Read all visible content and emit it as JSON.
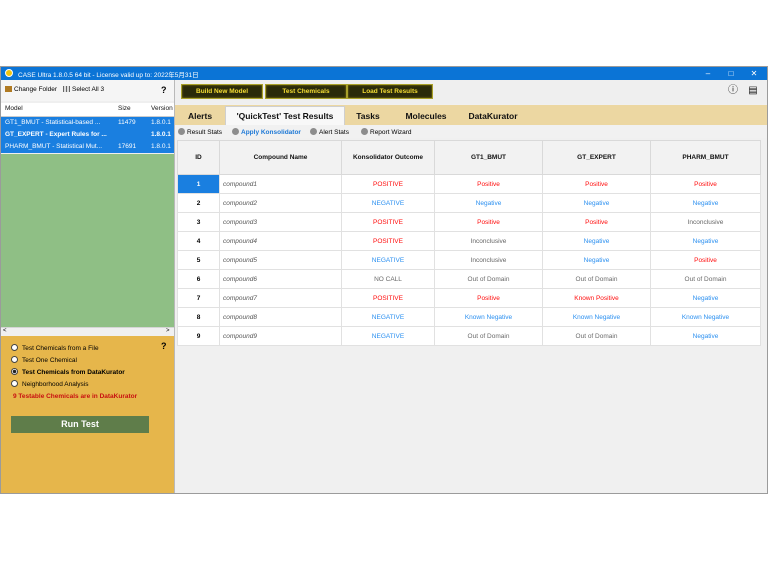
{
  "window": {
    "title": "CASE Ultra 1.8.0.5 64 bit  - License valid up to: 2022年5月31日",
    "controls": [
      "–",
      "□",
      "✕"
    ]
  },
  "left": {
    "toolbar": {
      "change_folder": "Change Folder",
      "select_all": "Select All 3",
      "help": "?"
    },
    "model_list": {
      "headers": {
        "model": "Model",
        "size": "Size",
        "version": "Version"
      },
      "rows": [
        {
          "model": "GT1_BMUT - Statistical-based ...",
          "size": "11479",
          "version": "1.8.0.1",
          "bold": false
        },
        {
          "model": "GT_EXPERT - Expert Rules for ...",
          "size": "",
          "version": "1.8.0.1",
          "bold": true
        },
        {
          "model": "PHARM_BMUT - Statistical Mut...",
          "size": "17691",
          "version": "1.8.0.1",
          "bold": false
        }
      ]
    },
    "scroll_left": "<",
    "scroll_right": ">",
    "options": {
      "help": "?",
      "items": [
        {
          "label": "Test Chemicals from a File",
          "selected": false
        },
        {
          "label": "Test One Chemical",
          "selected": false
        },
        {
          "label": "Test Chemicals from DataKurator",
          "selected": true
        },
        {
          "label": "Neighborhood Analysis",
          "selected": false
        }
      ],
      "status": "9 Testable Chemicals are in DataKurator",
      "run_button": "Run Test"
    }
  },
  "right": {
    "toolbar": {
      "build_model": "Build New Model",
      "test_chemicals": "Test Chemicals",
      "load_results": "Load Test Results",
      "info_icon": "ⓘ",
      "book_icon": "▤"
    },
    "tabs": [
      "Alerts",
      "'QuickTest' Test Results",
      "Tasks",
      "Molecules",
      "DataKurator"
    ],
    "active_tab": 1,
    "subtabs": [
      "Result Stats",
      "Apply Konsolidator",
      "Alert Stats",
      "Report Wizard"
    ],
    "active_subtab": 1,
    "table": {
      "headers": [
        "ID",
        "Compound Name",
        "Konsolidator Outcome",
        "GT1_BMUT",
        "GT_EXPERT",
        "PHARM_BMUT"
      ],
      "rows": [
        [
          "1",
          "compound1",
          "POSITIVE",
          "Positive",
          "Positive",
          "Positive"
        ],
        [
          "2",
          "compound2",
          "NEGATIVE",
          "Negative",
          "Negative",
          "Negative"
        ],
        [
          "3",
          "compound3",
          "POSITIVE",
          "Positive",
          "Positive",
          "Inconclusive"
        ],
        [
          "4",
          "compound4",
          "POSITIVE",
          "Inconclusive",
          "Negative",
          "Negative"
        ],
        [
          "5",
          "compound5",
          "NEGATIVE",
          "Inconclusive",
          "Negative",
          "Positive"
        ],
        [
          "6",
          "compound6",
          "NO CALL",
          "Out of Domain",
          "Out of Domain",
          "Out of Domain"
        ],
        [
          "7",
          "compound7",
          "POSITIVE",
          "Positive",
          "Known Positive",
          "Negative"
        ],
        [
          "8",
          "compound8",
          "NEGATIVE",
          "Known Negative",
          "Known Negative",
          "Known Negative"
        ],
        [
          "9",
          "compound9",
          "NEGATIVE",
          "Out of Domain",
          "Out of Domain",
          "Negative"
        ]
      ],
      "selected_row": 0
    },
    "colors": {
      "positive": "#ff0c0c",
      "negative": "#2a8ff0",
      "neutral": "#666666",
      "selection": "#1a7fe0"
    }
  }
}
